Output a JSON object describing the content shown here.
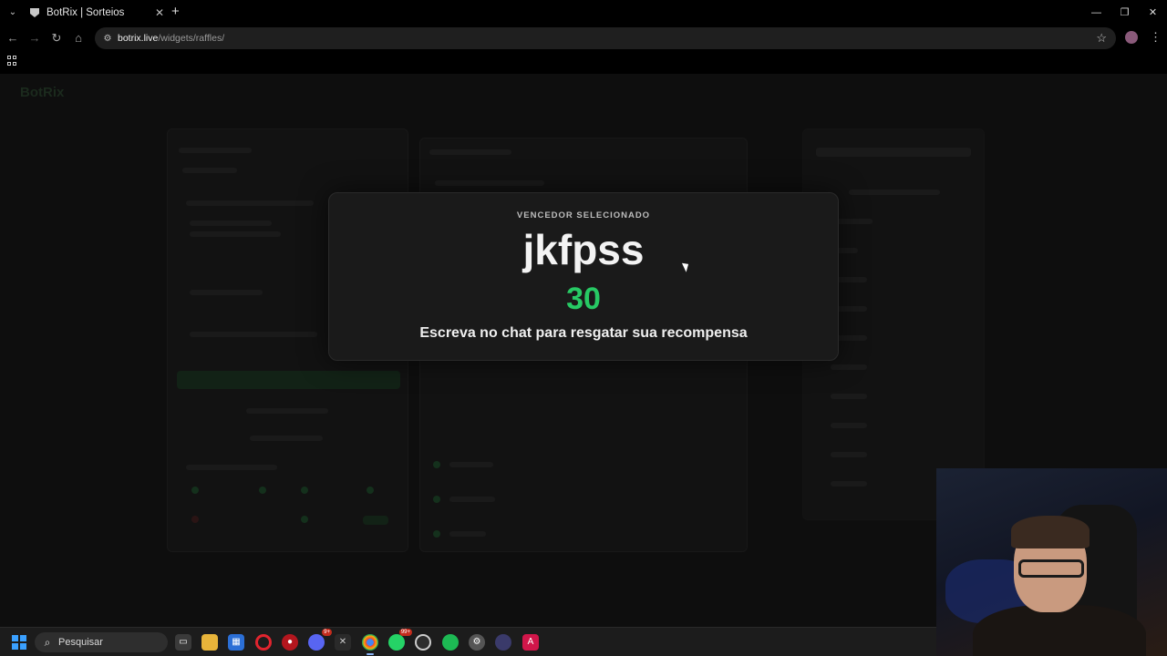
{
  "browser": {
    "tab_title": "BotRix | Sorteios",
    "tab_close": "✕",
    "new_tab": "+",
    "url_host": "botrix.live",
    "url_path": "/widgets/raffles/"
  },
  "page": {
    "background_logo": "BotRix"
  },
  "modal": {
    "label": "VENCEDOR SELECIONADO",
    "winner": "jkfpss",
    "count": "30",
    "message": "Escreva no chat para resgatar sua recompensa",
    "accent_color": "#27c964"
  },
  "taskbar": {
    "search_placeholder": "Pesquisar",
    "apps": [
      {
        "name": "task-view",
        "icon": "task-view-icon"
      },
      {
        "name": "file-explorer",
        "icon": "folder-icon"
      },
      {
        "name": "store",
        "icon": "store-icon"
      },
      {
        "name": "opera",
        "icon": "opera-icon"
      },
      {
        "name": "game",
        "icon": "game-icon"
      },
      {
        "name": "discord",
        "icon": "discord-icon",
        "badge": "9+"
      },
      {
        "name": "capcut",
        "icon": "capcut-icon"
      },
      {
        "name": "chrome",
        "icon": "chrome-icon",
        "active": true
      },
      {
        "name": "whatsapp",
        "icon": "whatsapp-icon",
        "badge": "99+"
      },
      {
        "name": "obs",
        "icon": "obs-icon"
      },
      {
        "name": "spotify",
        "icon": "spotify-icon"
      },
      {
        "name": "settings",
        "icon": "gear-icon"
      },
      {
        "name": "app-circle",
        "icon": "circle-app-icon"
      },
      {
        "name": "adobe",
        "icon": "adobe-icon"
      }
    ]
  }
}
